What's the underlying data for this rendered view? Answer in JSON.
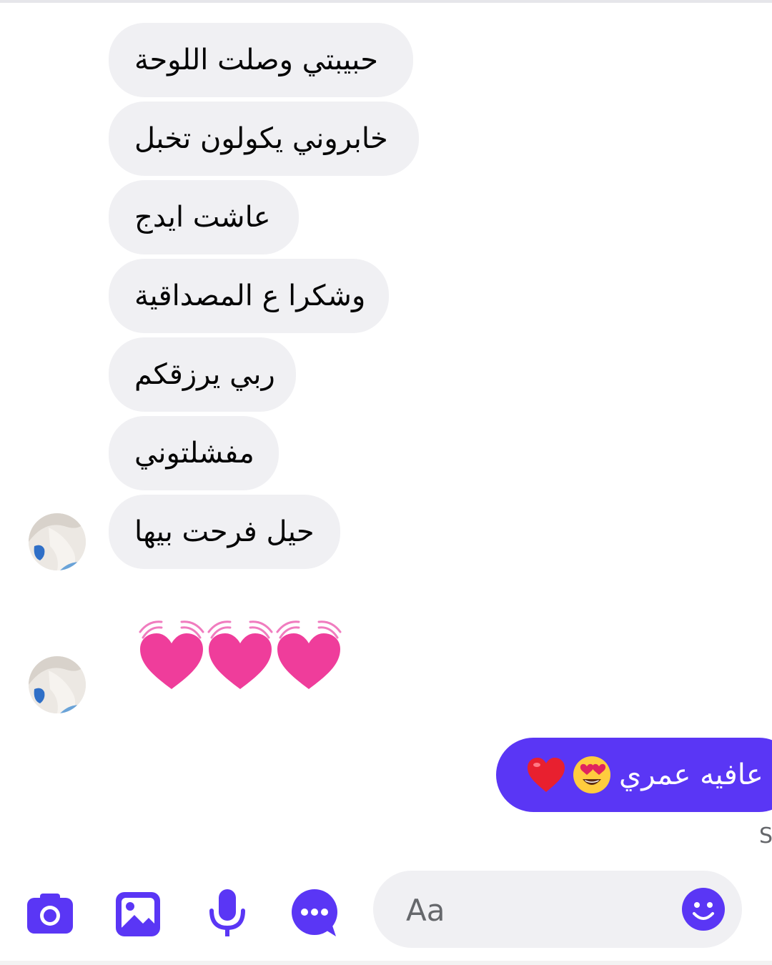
{
  "conversation": {
    "incoming_messages": [
      {
        "text": "حبيبتي وصلت اللوحة"
      },
      {
        "text": "خابروني يكولون تخبل"
      },
      {
        "text": "عاشت ايدج"
      },
      {
        "text": "وشكرا ع المصداقية"
      },
      {
        "text": "ربي يرزقكم"
      },
      {
        "text": "مفشلتوني"
      },
      {
        "text": "حيل فرحت بيها"
      }
    ],
    "reaction_emojis": [
      "💓",
      "💓",
      "💓"
    ],
    "outgoing_message": {
      "text": "ل عافيه عمري",
      "emojis": [
        "😍",
        "❤️"
      ]
    },
    "status_text": "S"
  },
  "composer": {
    "placeholder": "Aa",
    "icons": [
      "camera-icon",
      "image-icon",
      "microphone-icon",
      "more-icon",
      "emoji-icon"
    ]
  },
  "colors": {
    "accent": "#5a36f5",
    "incoming_bubble": "#f0f0f3",
    "heart_pink": "#ef3d9b"
  }
}
